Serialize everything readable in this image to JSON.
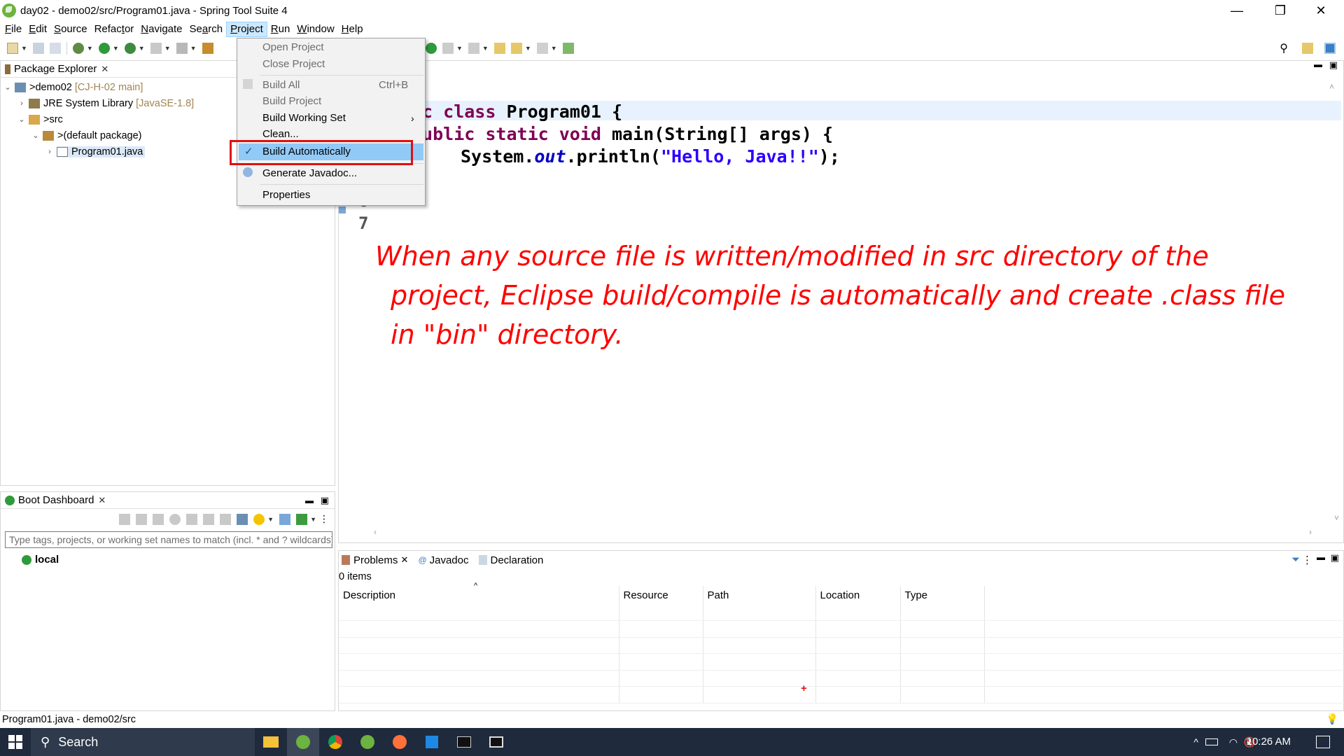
{
  "window": {
    "title": "day02 - demo02/src/Program01.java - Spring Tool Suite 4",
    "minimize": "—",
    "maximize": "❐",
    "close": "✕"
  },
  "menubar": {
    "items": [
      {
        "label": "File",
        "u": "F",
        "rest": "ile"
      },
      {
        "label": "Edit",
        "u": "E",
        "rest": "dit"
      },
      {
        "label": "Source",
        "u": "S",
        "rest": "ource"
      },
      {
        "label": "Refactor",
        "pre": "Refac",
        "u": "t",
        "rest": "or"
      },
      {
        "label": "Navigate",
        "u": "N",
        "rest": "avigate"
      },
      {
        "label": "Search",
        "pre": "Se",
        "u": "a",
        "rest": "rch"
      },
      {
        "label": "Project",
        "u": "P",
        "rest": "roject"
      },
      {
        "label": "Run",
        "u": "R",
        "rest": "un"
      },
      {
        "label": "Window",
        "u": "W",
        "rest": "indow"
      },
      {
        "label": "Help",
        "u": "H",
        "rest": "elp"
      }
    ]
  },
  "project_menu": {
    "open_project": "Open Project",
    "close_project": "Close Project",
    "build_all": "Build All",
    "build_all_shortcut": "Ctrl+B",
    "build_project": "Build Project",
    "build_working_set": "Build Working Set",
    "clean": "Clean...",
    "build_automatically": "Build Automatically",
    "build_automatically_checked": true,
    "generate_javadoc": "Generate Javadoc...",
    "properties": "Properties"
  },
  "package_explorer": {
    "tab_label": "Package Explorer",
    "tree": {
      "project": "demo02",
      "project_deco": "[CJ-H-02 main]",
      "jre": "JRE System Library",
      "jre_deco": "[JavaSE-1.8]",
      "src": "src",
      "package": "(default package)",
      "file": "Program01.java"
    }
  },
  "editor": {
    "tab_fragment": "a",
    "lines": {
      "l1_kw": "ic class",
      "l1_name": " Program01 {",
      "l2_kw": "public static void",
      "l2_rest": " main(String[] args) {",
      "l3_pre": "System.",
      "l3_field": "out",
      "l3_mid": ".println(",
      "l3_str": "\"Hello, Java!!\"",
      "l3_end": ");",
      "l4": "}",
      "ln6": "6",
      "ln7": "7"
    },
    "annotation": {
      "line1": "When any source file is written/modified in src directory of the",
      "line2": "project, Eclipse build/compile is automatically and create .class file",
      "line3": "in \"bin\" directory."
    }
  },
  "boot_dashboard": {
    "tab_label": "Boot Dashboard",
    "filter_placeholder": "Type tags, projects, or working set names to match (incl. * and ? wildcards)",
    "local": "local"
  },
  "problems": {
    "tabs": [
      "Problems",
      "Javadoc",
      "Declaration"
    ],
    "count": "0 items",
    "columns": [
      "Description",
      "Resource",
      "Path",
      "Location",
      "Type"
    ]
  },
  "statusbar": {
    "text": "Program01.java - demo02/src"
  },
  "taskbar": {
    "search": "Search",
    "time": "10:26 AM"
  }
}
